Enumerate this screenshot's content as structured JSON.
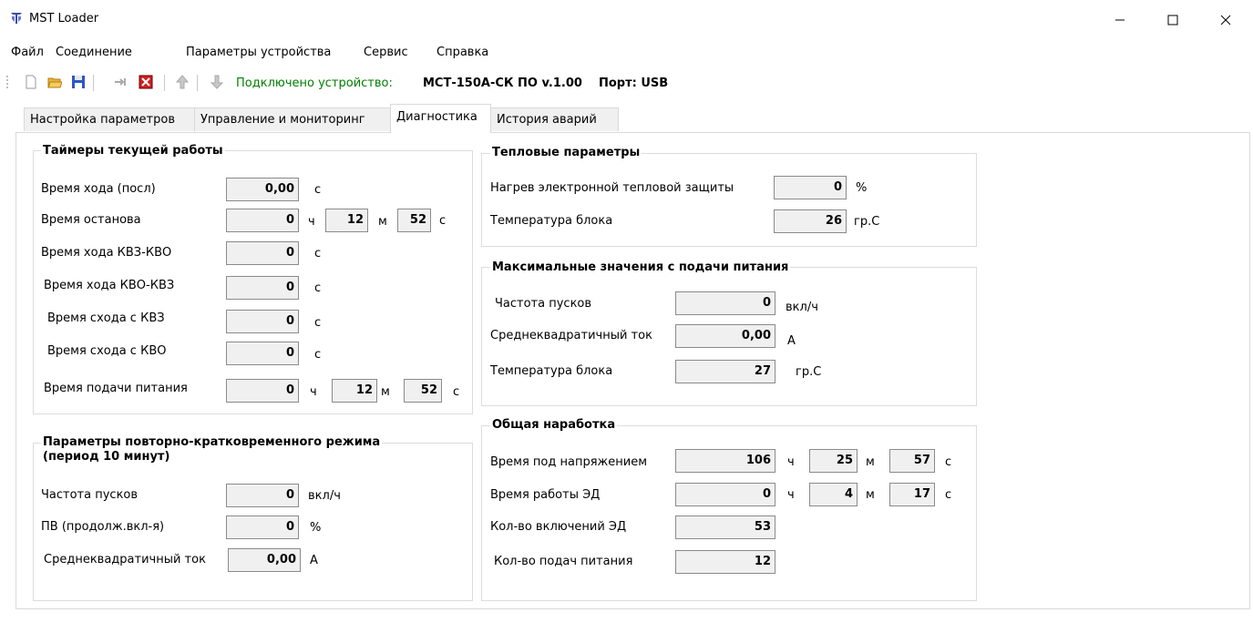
{
  "window": {
    "title": "MST Loader"
  },
  "menu": {
    "items": [
      "Файл",
      "Соединение",
      "Параметры устройства",
      "Сервис",
      "Справка"
    ]
  },
  "toolbar": {
    "status_prefix": "Подключено устройство:",
    "device": "МСТ-150А-СК ПО v.1.00",
    "port": "Порт: USB"
  },
  "tabs": [
    {
      "label": "Настройка параметров"
    },
    {
      "label": "Управление и мониторинг"
    },
    {
      "label": "Диагностика",
      "active": true
    },
    {
      "label": "История аварий"
    }
  ],
  "timers": {
    "title": "Таймеры текущей работы",
    "run_time_last": {
      "label": "Время хода (посл)",
      "value": "0,00",
      "unit": "с"
    },
    "stop_time": {
      "label": "Время останова",
      "h": "0",
      "m": "12",
      "s": "52"
    },
    "kvz_kvo": {
      "label": "Время хода КВЗ-КВО",
      "value": "0",
      "unit": "с"
    },
    "kvo_kvz": {
      "label": "Время хода КВО-КВЗ",
      "value": "0",
      "unit": "с"
    },
    "exit_kvz": {
      "label": "Время схода с КВЗ",
      "value": "0",
      "unit": "с"
    },
    "exit_kvo": {
      "label": "Время схода с КВО",
      "value": "0",
      "unit": "с"
    },
    "power_time": {
      "label": "Время подачи питания",
      "h": "0",
      "m": "12",
      "s": "52"
    }
  },
  "units": {
    "h": "ч",
    "m": "м",
    "s": "с"
  },
  "intermittent": {
    "title_line1": "Параметры повторно-кратковременного режима",
    "title_line2": "(период 10 минут)",
    "start_freq": {
      "label": "Частота пусков",
      "value": "0",
      "unit": "вкл/ч"
    },
    "duty": {
      "label": "ПВ (продолж.вкл-я)",
      "value": "0",
      "unit": "%"
    },
    "rms_current": {
      "label": "Среднеквадратичный ток",
      "value": "0,00",
      "unit": "А"
    }
  },
  "thermal": {
    "title": "Тепловые параметры",
    "heating": {
      "label": "Нагрев электронной тепловой защиты",
      "value": "0",
      "unit": "%"
    },
    "block_temp": {
      "label": "Температура блока",
      "value": "26",
      "unit": "гр.С"
    }
  },
  "max_values": {
    "title": "Максимальные значения с подачи питания",
    "start_freq": {
      "label": "Частота пусков",
      "value": "0",
      "unit": "вкл/ч"
    },
    "rms_current": {
      "label": "Среднеквадратичный ток",
      "value": "0,00",
      "unit": "А"
    },
    "block_temp": {
      "label": "Температура блока",
      "value": "27",
      "unit": "гр.С"
    }
  },
  "total": {
    "title": "Общая наработка",
    "powered_time": {
      "label": "Время под напряжением",
      "h": "106",
      "m": "25",
      "s": "57"
    },
    "motor_time": {
      "label": "Время работы ЭД",
      "h": "0",
      "m": "4",
      "s": "17"
    },
    "motor_starts": {
      "label": "Кол-во включений ЭД",
      "value": "53"
    },
    "power_ups": {
      "label": "Кол-во подач питания",
      "value": "12"
    }
  }
}
